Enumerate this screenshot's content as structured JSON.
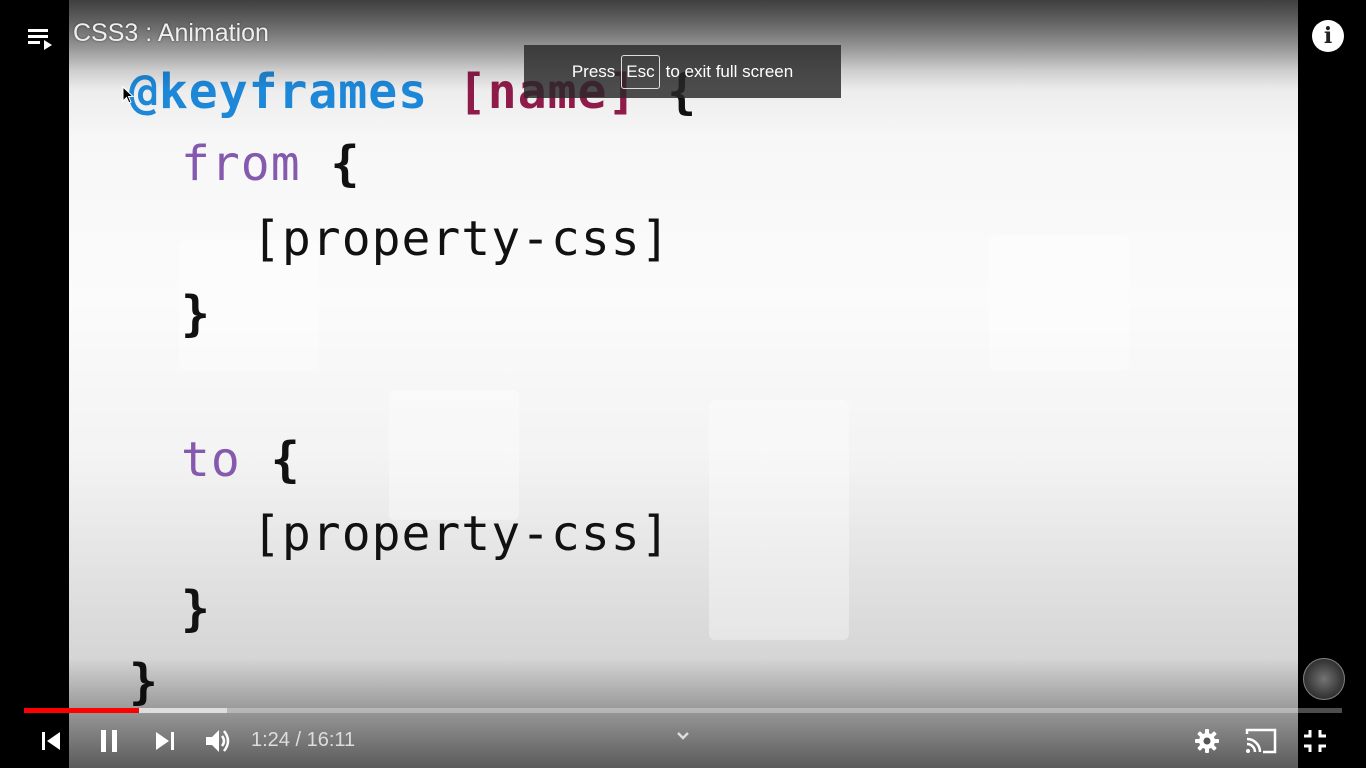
{
  "video": {
    "title": "CSS3 : Animation",
    "code_lines": [
      {
        "text1": "@keyframes",
        "text2": "[name]",
        "text3": "{"
      },
      {
        "kw": "from",
        "brace": "{"
      },
      {
        "text": "[property-css]"
      },
      {
        "brace": "}"
      },
      {
        "kw": "to",
        "brace": "{"
      },
      {
        "text": "[property-css]"
      },
      {
        "brace": "}"
      },
      {
        "brace": "}"
      }
    ]
  },
  "toast": {
    "press": "Press",
    "key": "Esc",
    "message": "to exit full screen"
  },
  "progress": {
    "played_fraction": 0.087,
    "buffered_fraction": 0.154,
    "played_color": "#ff0000"
  },
  "controls": {
    "current_time": "1:24",
    "separator": " / ",
    "duration": "16:11"
  },
  "icons": {
    "playlist": "playlist-icon",
    "info": "info-icon",
    "prev": "previous-icon",
    "pause": "pause-icon",
    "next": "next-icon",
    "volume": "volume-icon",
    "chevron": "chevron-down-icon",
    "settings": "gear-icon",
    "cast": "cast-icon",
    "exit_fullscreen": "exit-fullscreen-icon"
  },
  "info_glyph": "i"
}
